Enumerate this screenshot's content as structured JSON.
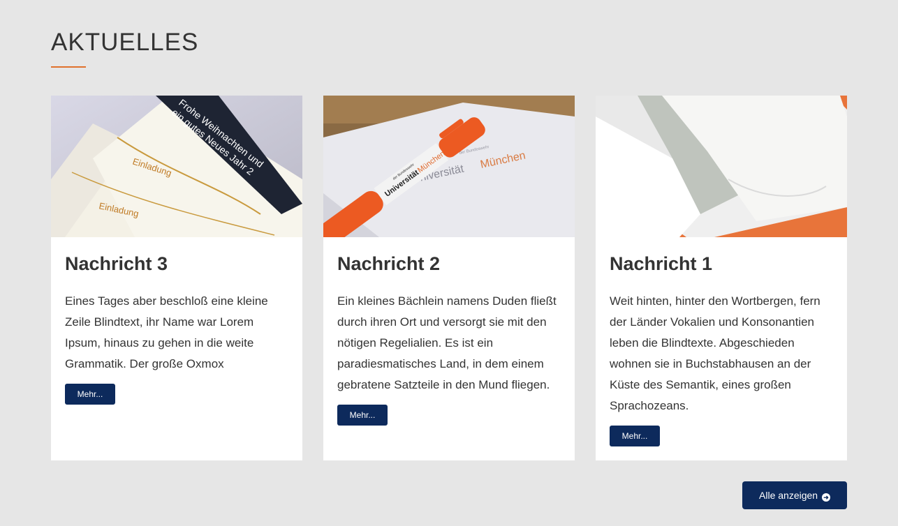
{
  "section": {
    "title": "AKTUELLES"
  },
  "colors": {
    "accent": "#e0712c",
    "button": "#0d2a5c",
    "background": "#e6e6e6"
  },
  "cards": [
    {
      "title": "Nachricht 3",
      "text": "Eines Tages aber beschloß eine kleine Zeile Blindtext, ihr Name war Lorem Ipsum, hinaus zu gehen in die weite Grammatik. Der große Oxmox",
      "button_label": "Mehr...",
      "image": {
        "line1": "Frohe Weihnachten und",
        "line2": "ein gutes Neues Jahr 2",
        "label_a": "Einladung",
        "label_b": "Einladung"
      }
    },
    {
      "title": "Nachricht 2",
      "text": "Ein kleines Bächlein namens Duden fließt durch ihren Ort und versorgt sie mit den nötigen Regelialien. Es ist ein paradiesmatisches Land, in dem einem gebratene Satzteile in den Mund fliegen.",
      "button_label": "Mehr...",
      "image": {
        "paper_small": "der Bundeswehr",
        "paper_left": "Universität",
        "paper_right": "München",
        "pen_small": "der Bundeswehr",
        "pen_left": "Universität",
        "pen_right": "München"
      }
    },
    {
      "title": "Nachricht 1",
      "text": "Weit hinten, hinter den Wortbergen, fern der Länder Vokalien und Konsonantien leben die Blindtexte. Abgeschieden wohnen sie in Buchstabhausen an der Küste des Semantik, eines großen Sprachozeans.",
      "button_label": "Mehr...",
      "image": {}
    }
  ],
  "footer": {
    "all_label": "Alle anzeigen",
    "all_icon": "arrow-circle-right-icon"
  }
}
